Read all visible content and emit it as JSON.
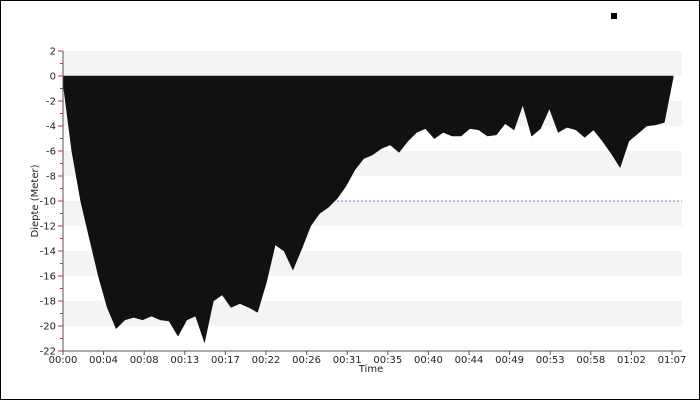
{
  "chart_data": {
    "type": "area",
    "xlabel": "Time",
    "ylabel": "Diepte (Meter)",
    "ylim": [
      -22,
      2
    ],
    "x_ticks": [
      "00:00",
      "00:04",
      "00:08",
      "00:13",
      "00:17",
      "00:22",
      "00:26",
      "00:31",
      "00:35",
      "00:40",
      "00:44",
      "00:49",
      "00:53",
      "00:58",
      "01:02",
      "01:07"
    ],
    "y_ticks": [
      2,
      0,
      -2,
      -4,
      -6,
      -8,
      -10,
      -12,
      -14,
      -16,
      -18,
      -20,
      -22
    ],
    "reference_line": {
      "value": -10,
      "from": "00:31",
      "to": "01:10"
    },
    "grid": "alternating horizontal bands",
    "legend": "top-right",
    "colors": {
      "fill": "#111111",
      "band": "#f4f4f4",
      "reference": "#6b6bdc",
      "axis": "#555555"
    },
    "series": [
      {
        "t": [
          "00:00",
          "00:01",
          "00:02",
          "00:03",
          "00:04",
          "00:05",
          "00:06",
          "00:07",
          "00:08",
          "00:09",
          "00:10",
          "00:11",
          "00:12",
          "00:13",
          "00:14",
          "00:15",
          "00:16",
          "00:17",
          "00:18",
          "00:19",
          "00:20",
          "00:21",
          "00:22",
          "00:23",
          "00:24",
          "00:25",
          "00:26",
          "00:27",
          "00:28",
          "00:29",
          "00:30",
          "00:31",
          "00:32",
          "00:33",
          "00:34",
          "00:35",
          "00:36",
          "00:37",
          "00:38",
          "00:39",
          "00:40",
          "00:41",
          "00:42",
          "00:43",
          "00:44",
          "00:45",
          "00:46",
          "00:47",
          "00:48",
          "00:49",
          "00:50",
          "00:51",
          "00:52",
          "00:53",
          "00:54",
          "00:55",
          "00:56",
          "00:57",
          "00:58",
          "00:59",
          "01:00",
          "01:01",
          "01:02",
          "01:03",
          "01:04",
          "01:05",
          "01:06",
          "01:07",
          "01:08",
          "01:09"
        ],
        "values": [
          -0.5,
          -6,
          -10,
          -13,
          -16,
          -18.5,
          -20.2,
          -19.5,
          -19.3,
          -19.5,
          -19.2,
          -19.5,
          -19.6,
          -20.8,
          -19.5,
          -19.2,
          -21.3,
          -18,
          -17.5,
          -18.5,
          -18.2,
          -18.5,
          -18.9,
          -16.5,
          -13.5,
          -14,
          -15.5,
          -13.8,
          -12,
          -11,
          -10.5,
          -9.8,
          -8.8,
          -7.5,
          -6.6,
          -6.3,
          -5.8,
          -5.5,
          -6.1,
          -5.2,
          -4.5,
          -4.2,
          -5,
          -4.5,
          -4.8,
          -4.8,
          -4.2,
          -4.3,
          -4.8,
          -4.7,
          -3.8,
          -4.3,
          -2.3,
          -4.8,
          -4.2,
          -2.6,
          -4.5,
          -4.1,
          -4.3,
          -4.9,
          -4.3,
          -5.2,
          -6.2,
          -7.3,
          -5.2,
          -4.6,
          -4,
          -3.9,
          -3.7,
          -0.1
        ]
      }
    ]
  }
}
